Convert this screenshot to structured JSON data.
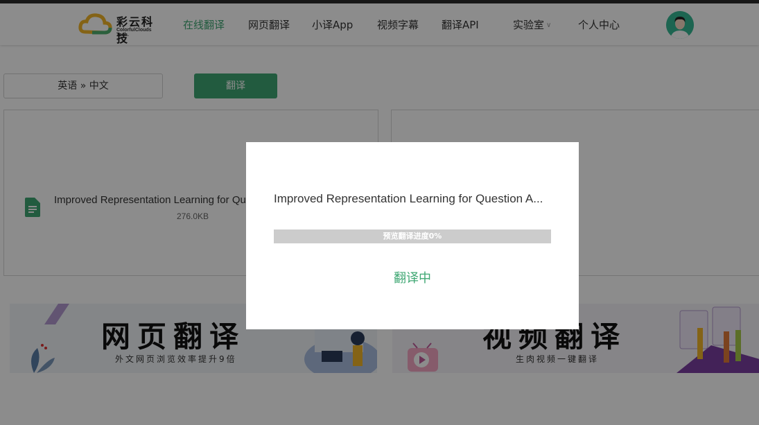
{
  "header": {
    "logo_cn": "彩云科技",
    "logo_en": "ColorfulClouds Tech.",
    "nav": [
      {
        "label": "在线翻译",
        "active": true
      },
      {
        "label": "网页翻译"
      },
      {
        "label": "小译App"
      },
      {
        "label": "视频字幕"
      },
      {
        "label": "翻译API"
      },
      {
        "label": "实验室"
      },
      {
        "label": "个人中心"
      }
    ]
  },
  "toolbar": {
    "language_pair": "英语 » 中文",
    "translate_label": "翻译"
  },
  "document": {
    "file_name": "Improved Representation Learning for Qu",
    "file_size": "276.0KB"
  },
  "banners": [
    {
      "title": "网页翻译",
      "subtitle": "外文网页浏览效率提升9倍"
    },
    {
      "title": "视频翻译",
      "subtitle": "生肉视频一键翻译"
    }
  ],
  "modal": {
    "file_name": "Improved Representation Learning for Question A...",
    "progress_text": "预览翻译进度0%",
    "progress_fraction": 0,
    "status": "翻译中"
  },
  "colors": {
    "accent": "#3fa773",
    "overlay": "rgba(0,0,0,0.45)"
  }
}
